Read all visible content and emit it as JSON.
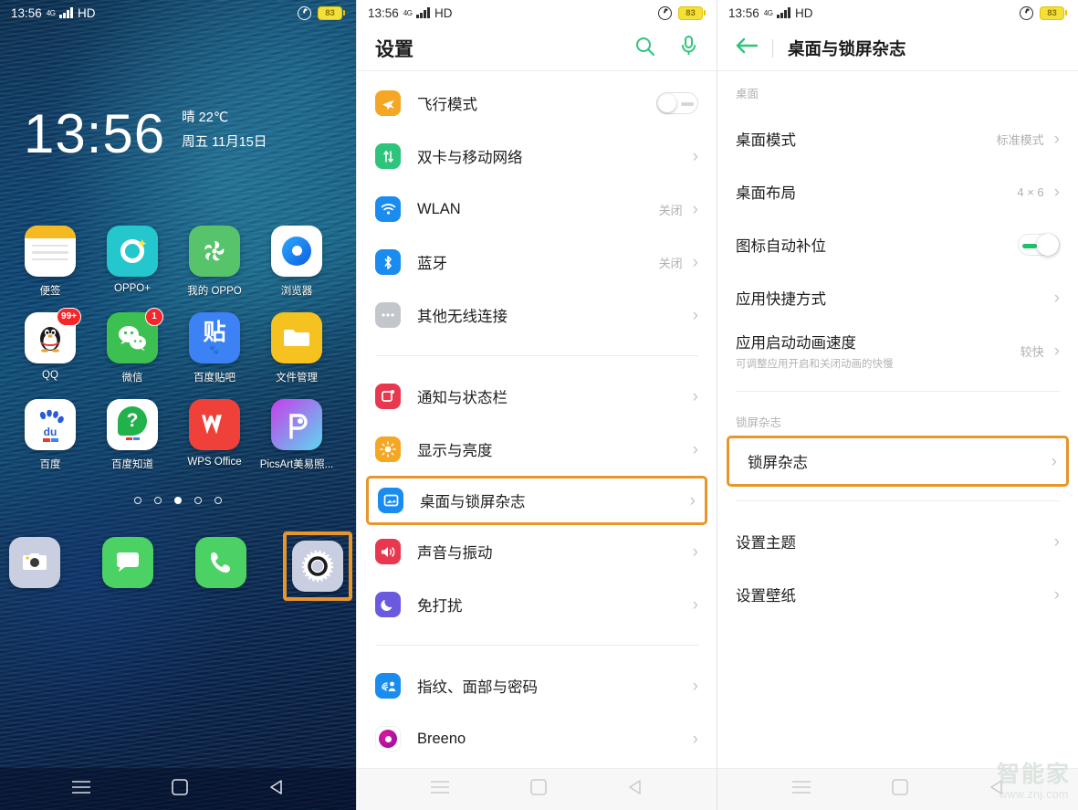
{
  "statusbar": {
    "time": "13:56",
    "network": "4G",
    "hd_label": "HD",
    "battery_percent": "83",
    "alarm_icon": "alarm-clock-icon",
    "signal_icon": "signal-bars-icon"
  },
  "home": {
    "clock": "13:56",
    "weather": "晴 22℃",
    "date": "周五  11月15日",
    "page_dots_total": 5,
    "page_dot_active": 3,
    "apps": [
      [
        {
          "label": "便签",
          "icon": "notes-icon"
        },
        {
          "label": "OPPO+",
          "icon": "oppo-plus-icon"
        },
        {
          "label": "我的 OPPO",
          "icon": "my-oppo-icon"
        },
        {
          "label": "浏览器",
          "icon": "browser-icon"
        }
      ],
      [
        {
          "label": "QQ",
          "icon": "qq-icon",
          "badge": "99+"
        },
        {
          "label": "微信",
          "icon": "wechat-icon",
          "badge": "1"
        },
        {
          "label": "百度贴吧",
          "icon": "baidu-tieba-icon"
        },
        {
          "label": "文件管理",
          "icon": "file-manager-icon"
        }
      ],
      [
        {
          "label": "百度",
          "icon": "baidu-icon"
        },
        {
          "label": "百度知道",
          "icon": "baidu-zhidao-icon"
        },
        {
          "label": "WPS Office",
          "icon": "wps-office-icon"
        },
        {
          "label": "PicsArt美易照...",
          "icon": "picsart-icon"
        }
      ]
    ],
    "dock": [
      {
        "name": "camera-icon",
        "label": "相机"
      },
      {
        "name": "messages-icon",
        "label": "信息"
      },
      {
        "name": "phone-icon",
        "label": "电话"
      },
      {
        "name": "settings-icon",
        "label": "设置",
        "highlighted": true
      }
    ]
  },
  "settings": {
    "title": "设置",
    "search_icon": "search-icon",
    "mic_icon": "microphone-icon",
    "groups": [
      {
        "rows": [
          {
            "label": "飞行模式",
            "icon": "airplane-icon",
            "icon_color": "#F5A623",
            "control": "toggle-off"
          },
          {
            "label": "双卡与移动网络",
            "icon": "sim-card-icon",
            "icon_color": "#2FC47C",
            "control": "chevron"
          },
          {
            "label": "WLAN",
            "icon": "wifi-icon",
            "icon_color": "#1A8CF0",
            "value": "关闭",
            "control": "chevron"
          },
          {
            "label": "蓝牙",
            "icon": "bluetooth-icon",
            "icon_color": "#1A8CF0",
            "value": "关闭",
            "control": "chevron"
          },
          {
            "label": "其他无线连接",
            "icon": "more-dots-icon",
            "icon_color": "#C3C7CC",
            "control": "chevron"
          }
        ]
      },
      {
        "rows": [
          {
            "label": "通知与状态栏",
            "icon": "notification-icon",
            "icon_color": "#E8384F",
            "control": "chevron"
          },
          {
            "label": "显示与亮度",
            "icon": "brightness-icon",
            "icon_color": "#F5A623",
            "control": "chevron"
          },
          {
            "label": "桌面与锁屏杂志",
            "icon": "wallpaper-icon",
            "icon_color": "#1A8CF0",
            "control": "chevron",
            "highlighted": true
          },
          {
            "label": "声音与振动",
            "icon": "volume-icon",
            "icon_color": "#E8384F",
            "control": "chevron"
          },
          {
            "label": "免打扰",
            "icon": "moon-icon",
            "icon_color": "#6A5AE0",
            "control": "chevron"
          }
        ]
      },
      {
        "rows": [
          {
            "label": "指纹、面部与密码",
            "icon": "fingerprint-icon",
            "icon_color": "#1A8CF0",
            "control": "chevron"
          },
          {
            "label": "Breeno",
            "icon": "breeno-icon",
            "icon_color": "#C0108A",
            "control": "chevron"
          }
        ]
      }
    ]
  },
  "detail": {
    "back_icon": "back-arrow-icon",
    "title": "桌面与锁屏杂志",
    "sections": [
      {
        "label": "桌面",
        "rows": [
          {
            "label": "桌面模式",
            "value": "标准模式",
            "control": "chevron"
          },
          {
            "label": "桌面布局",
            "value": "4 × 6",
            "control": "chevron"
          },
          {
            "label": "图标自动补位",
            "control": "toggle-on"
          },
          {
            "label": "应用快捷方式",
            "control": "chevron"
          },
          {
            "label": "应用启动动画速度",
            "sub": "可调整应用开启和关闭动画的快慢",
            "value": "较快",
            "control": "chevron"
          }
        ]
      },
      {
        "label": "锁屏杂志",
        "rows": [
          {
            "label": "锁屏杂志",
            "control": "chevron",
            "highlighted": true
          }
        ]
      },
      {
        "label": "",
        "rows": [
          {
            "label": "设置主题",
            "control": "chevron"
          },
          {
            "label": "设置壁纸",
            "control": "chevron"
          }
        ]
      }
    ]
  },
  "navbar": {
    "recents": "recents-menu-icon",
    "home": "home-square-icon",
    "back": "back-triangle-icon"
  },
  "watermark": {
    "cn": "智能家",
    "url": "www.znj.com"
  },
  "colors": {
    "accent_highlight": "#E8952A",
    "brand_green": "#2FC47C",
    "toggle_on": "#1CC16A"
  }
}
